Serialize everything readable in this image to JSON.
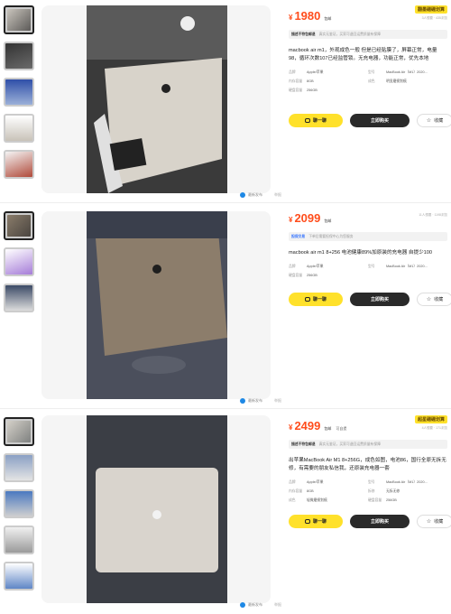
{
  "listings": [
    {
      "price_symbol": "¥",
      "price": "1980",
      "shipping": "包邮",
      "shipping_extra": "",
      "meta": "3人想要 · 435浏览",
      "badge": "翻墨硼硼划算",
      "notice_lead": "描述不符包邮退",
      "notice_text": "真实无鉴证，买家可退回运费质量有保障",
      "description": "macbook air m1，外观成色一般 但是已经贴膜了，屏幕正常，电量98，循环次数107已经监管锁。无充电器，功能正常，优先本地",
      "attrs": [
        {
          "k": "品牌",
          "v": "Apple/苹果"
        },
        {
          "k": "型号",
          "v": "MacBook Air（M1）2020..."
        },
        {
          "k": "内存容量",
          "v": "8GB"
        },
        {
          "k": "成色",
          "v": "明显磨损划痕"
        },
        {
          "k": "硬盘容量",
          "v": "256GB"
        }
      ],
      "chat": "聊一聊",
      "buy": "立即购买",
      "fav": "收藏",
      "caption": "最新发布",
      "caption_ghost": "举报"
    },
    {
      "price_symbol": "¥",
      "price": "2099",
      "shipping": "包邮",
      "shipping_extra": "",
      "meta": "11人想要 · 1198浏览",
      "badge": "",
      "notice_lead": "担保交易",
      "notice_text": "下单后需要担保中心为您服务",
      "description": "macbook air m1 8+256 电池健康89%加原装的充电器 自提少100",
      "attrs": [
        {
          "k": "品牌",
          "v": "Apple/苹果"
        },
        {
          "k": "型号",
          "v": "MacBook Air（M1）2020..."
        },
        {
          "k": "硬盘容量",
          "v": "256GB"
        }
      ],
      "chat": "聊一聊",
      "buy": "立即购买",
      "fav": "收藏",
      "caption": "最新发布",
      "caption_ghost": "举报"
    },
    {
      "price_symbol": "¥",
      "price": "2499",
      "shipping": "包邮",
      "shipping_extra": "可自提",
      "meta": "4人想要 · 171浏览",
      "badge": "超星硼硼划算",
      "notice_lead": "描述不符包邮退",
      "notice_text": "真实无鉴证，买家可退回运费质量有保障",
      "description": "出苹果MacBook Air M1 8+256G，成色如图，电池86，国行全原无拆无修，有需要的朋友私信我，还原装充电器一套",
      "attrs": [
        {
          "k": "品牌",
          "v": "Apple/苹果"
        },
        {
          "k": "型号",
          "v": "MacBook Air（M1）2020..."
        },
        {
          "k": "内存容量",
          "v": "8GB"
        },
        {
          "k": "拆修",
          "v": "无拆无修"
        },
        {
          "k": "成色",
          "v": "轻微磨损划痕"
        },
        {
          "k": "硬盘容量",
          "v": "256GB"
        }
      ],
      "chat": "聊一聊",
      "buy": "立即购买",
      "fav": "收藏",
      "caption": "最新发布",
      "caption_ghost": "举报"
    }
  ]
}
